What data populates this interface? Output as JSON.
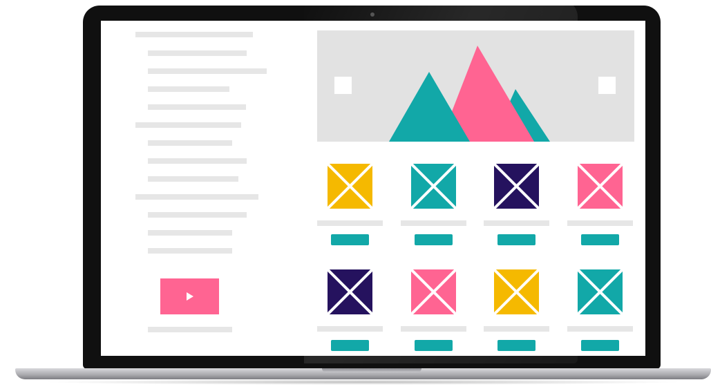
{
  "colors": {
    "teal": "#12a8a8",
    "pink": "#ff6492",
    "yellow": "#f5b900",
    "navy": "#25125e",
    "placeholder_gray": "#e6e6e6",
    "hero_gray": "#e2e2e2"
  },
  "video": {
    "icon": "play-icon"
  },
  "hero": {
    "icons": [
      "carousel-prev-arrow",
      "carousel-next-arrow"
    ],
    "mountains": [
      "teal",
      "pink",
      "teal"
    ]
  },
  "products": {
    "rows": [
      [
        "yellow",
        "teal",
        "navy",
        "pink"
      ],
      [
        "navy",
        "pink",
        "yellow",
        "teal"
      ]
    ],
    "icon": "image-placeholder-icon"
  }
}
